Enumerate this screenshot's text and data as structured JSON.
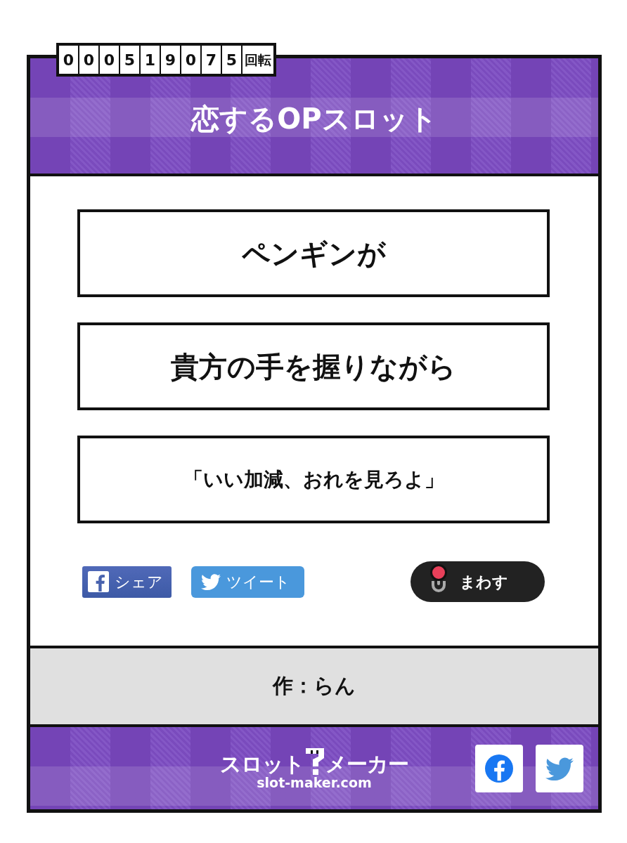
{
  "counter": {
    "digits": [
      "0",
      "0",
      "0",
      "5",
      "1",
      "9",
      "0",
      "7",
      "5"
    ],
    "unit": "回転"
  },
  "title": "恋するOPスロット",
  "reels": [
    {
      "kind": "main",
      "text": "ペンギンが"
    },
    {
      "kind": "main",
      "text": "貴方の手を握りながら"
    },
    {
      "kind": "quote",
      "text": "「いい加減、おれを見ろよ」"
    }
  ],
  "share_buttons": [
    {
      "kind": "facebook",
      "label": "シェア"
    },
    {
      "kind": "twitter",
      "label": "ツイート"
    }
  ],
  "spin_button": {
    "label": "まわす"
  },
  "author": "作：らん",
  "footer": {
    "logo": {
      "left": "スロット",
      "right": "メーカー",
      "domain": "slot-maker.com"
    },
    "social": [
      {
        "kind": "facebook"
      },
      {
        "kind": "twitter"
      }
    ]
  }
}
